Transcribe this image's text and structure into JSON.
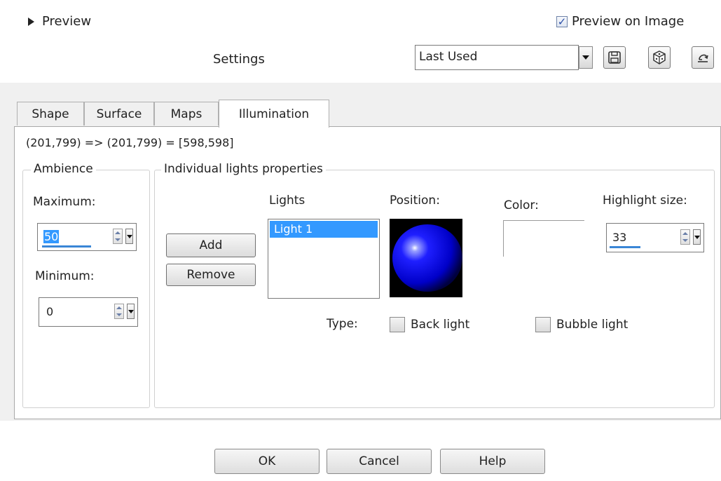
{
  "header": {
    "preview_label": "Preview",
    "preview_on_image_label": "Preview on Image",
    "preview_on_image_checked": true,
    "settings_label": "Settings",
    "settings_value": "Last Used"
  },
  "tabs": [
    {
      "label": "Shape",
      "active": false
    },
    {
      "label": "Surface",
      "active": false
    },
    {
      "label": "Maps",
      "active": false
    },
    {
      "label": "Illumination",
      "active": true
    }
  ],
  "coords_text": "(201,799) => (201,799) = [598,598]",
  "ambience": {
    "title": "Ambience",
    "maximum_label": "Maximum:",
    "maximum_value": "50",
    "minimum_label": "Minimum:",
    "minimum_value": "0"
  },
  "lights": {
    "title": "Individual lights properties",
    "add_label": "Add",
    "remove_label": "Remove",
    "lights_label": "Lights",
    "items": [
      "Light 1"
    ],
    "position_label": "Position:",
    "color_label": "Color:",
    "highlight_label": "Highlight size:",
    "highlight_value": "33",
    "type_label": "Type:",
    "back_light_label": "Back light",
    "bubble_light_label": "Bubble light"
  },
  "footer": {
    "ok_label": "OK",
    "cancel_label": "Cancel",
    "help_label": "Help"
  },
  "colors": {
    "accent": "#3a86d6",
    "selection": "#3399ff",
    "sphere": "#0000ff"
  },
  "icons": [
    "triangle-right-icon",
    "checkbox-icon",
    "save-icon",
    "randomize-icon",
    "reset-icon",
    "chevron-down-icon",
    "spin-up-down-icon"
  ]
}
